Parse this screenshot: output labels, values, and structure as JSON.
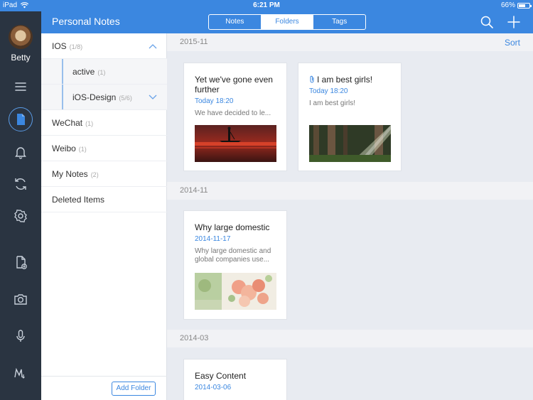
{
  "status_bar": {
    "device": "iPad",
    "time": "6:21 PM",
    "battery": "66%",
    "battery_level": 0.66
  },
  "header": {
    "title": "Personal Notes",
    "tabs": [
      {
        "label": "Notes",
        "active": false
      },
      {
        "label": "Folders",
        "active": true
      },
      {
        "label": "Tags",
        "active": false
      }
    ],
    "icons": [
      "search-icon",
      "add-icon"
    ]
  },
  "rail": {
    "user_name": "Betty",
    "icons": [
      "menu-icon",
      "note-icon",
      "bell-icon",
      "sync-icon",
      "settings-icon",
      "new-file-icon",
      "camera-icon",
      "microphone-icon",
      "markdown-icon"
    ]
  },
  "folders": {
    "items": [
      {
        "label": "IOS",
        "count": "(1/8)"
      },
      {
        "label": "active",
        "count": "(1)"
      },
      {
        "label": "iOS-Design",
        "count": "(5/6)"
      },
      {
        "label": "WeChat",
        "count": "(1)"
      },
      {
        "label": "Weibo",
        "count": "(1)"
      },
      {
        "label": "My Notes",
        "count": "(2)"
      },
      {
        "label": "Deleted Items",
        "count": ""
      }
    ],
    "add_folder": "Add Folder"
  },
  "content": {
    "sort_label": "Sort",
    "sections": [
      {
        "date": "2015-11",
        "cards": [
          {
            "title": "Yet we've gone even further",
            "date": "Today 18:20",
            "excerpt": "We have decided to le..."
          },
          {
            "title": "I am best girls!",
            "date": "Today 18:20",
            "excerpt": "I am best girls!"
          }
        ]
      },
      {
        "date": "2014-11",
        "cards": [
          {
            "title": "Why large domestic",
            "date": "2014-11-17",
            "excerpt": "Why large domestic and global companies use..."
          }
        ]
      },
      {
        "date": "2014-03",
        "cards": [
          {
            "title": "Easy Content",
            "date": "2014-03-06",
            "excerpt": ""
          }
        ]
      }
    ]
  },
  "colors": {
    "accent": "#3b87e0",
    "rail": "#2a3441",
    "background": "#e8ebf1"
  }
}
